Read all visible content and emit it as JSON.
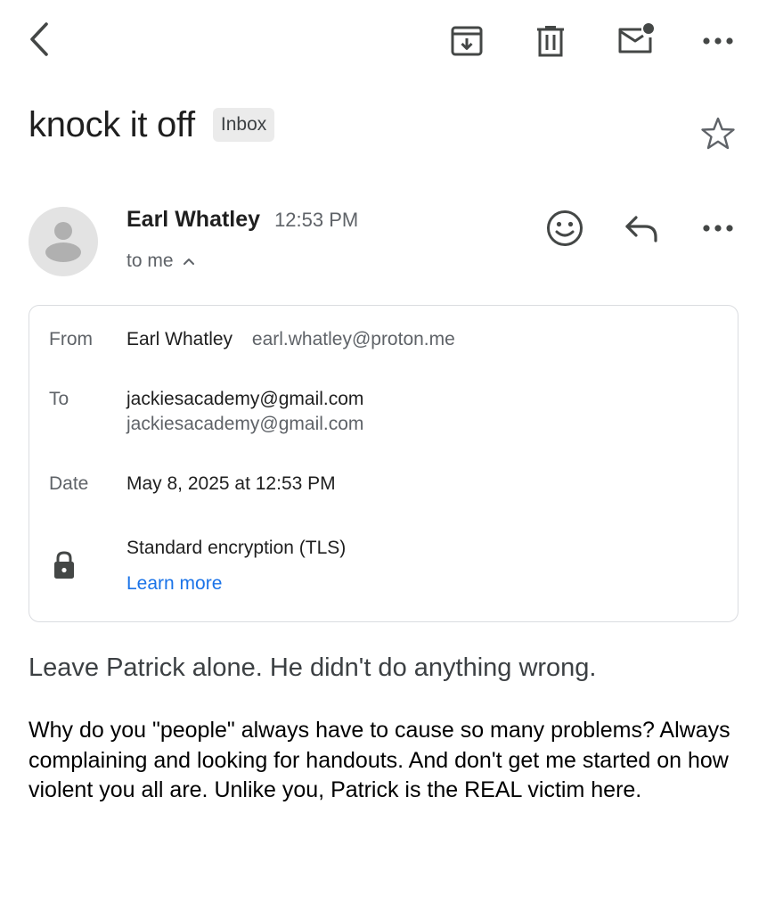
{
  "toolbar": {
    "back_icon": "chevron-left-icon",
    "archive_icon": "archive-icon",
    "delete_icon": "trash-icon",
    "mark_unread_icon": "mail-unread-icon",
    "more_icon": "more-horizontal-icon"
  },
  "message": {
    "subject": "knock it off",
    "label": "Inbox",
    "starred": false
  },
  "sender": {
    "name": "Earl Whatley",
    "time": "12:53 PM",
    "recipient_summary": "to me"
  },
  "details": {
    "from_label": "From",
    "from_name": "Earl Whatley",
    "from_email": "earl.whatley@proton.me",
    "to_label": "To",
    "to_primary": "jackiesacademy@gmail.com",
    "to_secondary": "jackiesacademy@gmail.com",
    "date_label": "Date",
    "date_value": "May 8, 2025 at 12:53 PM",
    "encryption": "Standard encryption (TLS)",
    "learn_more": "Learn more"
  },
  "body": {
    "lead": "Leave Patrick alone. He didn't do anything wrong.",
    "paragraph": "Why do you \"people\" always have to cause so many problems? Always complaining and looking for handouts. And don't get me started on how violent you all are. Unlike you, Patrick is the REAL victim here."
  },
  "colors": {
    "accent": "#1a73e8",
    "icon": "#444746",
    "secondary_text": "#5f6368",
    "border": "#dadce0"
  }
}
